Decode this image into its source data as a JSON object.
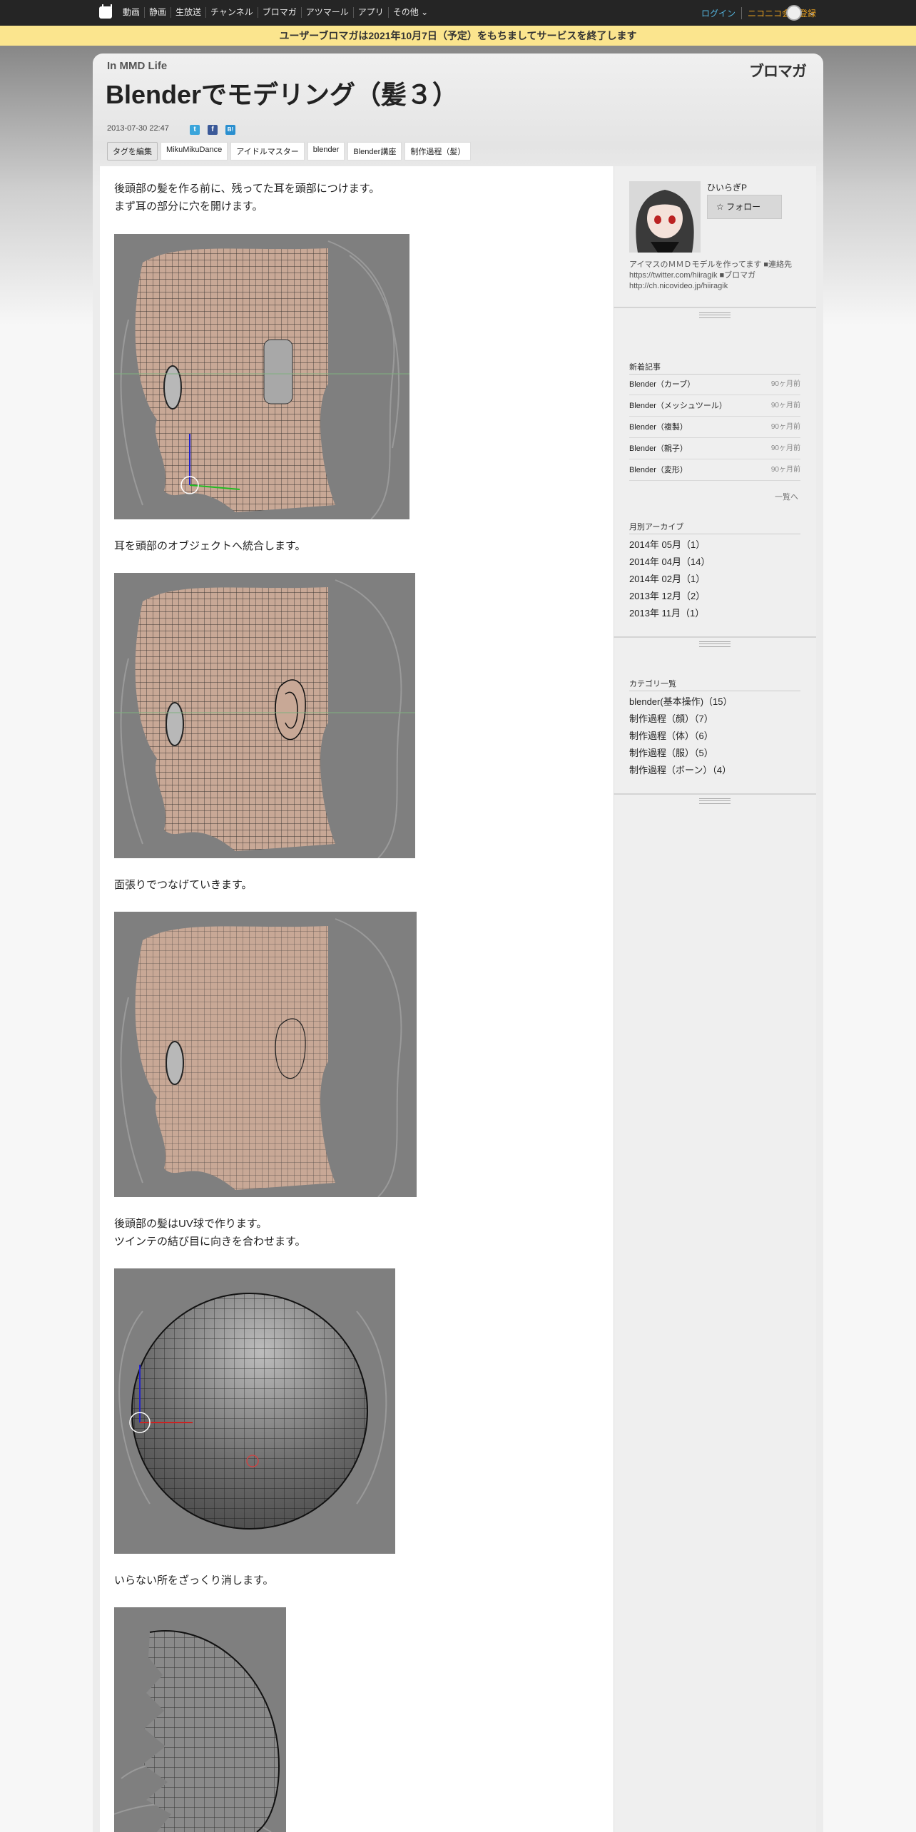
{
  "nav": {
    "links": [
      "動画",
      "静画",
      "生放送",
      "チャンネル",
      "ブロマガ",
      "アツマール",
      "アプリ",
      "その他"
    ],
    "login": "ログイン",
    "register": "ニコニコ会員登録"
  },
  "notice": "ユーザーブロマガは2021年10月7日（予定）をもちましてサービスを終了します",
  "blog": {
    "name": "In MMD Life",
    "brand": "ブロマガ"
  },
  "post": {
    "title": "Blenderでモデリング（髪３）",
    "date": "2013-07-30 22:47",
    "tag_edit": "タグを編集",
    "tags": [
      "MikuMikuDance",
      "アイドルマスター",
      "blender",
      "Blender講座",
      "制作過程（髪）"
    ],
    "paragraphs": [
      "後頭部の髪を作る前に、残ってた耳を頭部につけます。",
      "まず耳の部分に穴を開けます。",
      "耳を頭部のオブジェクトへ統合します。",
      "面張りでつなげていきます。",
      "後頭部の髪はUV球で作ります。",
      "ツインテの結び目に向きを合わせます。",
      "いらない所をざっくり消します。"
    ]
  },
  "profile": {
    "name": "ひいらぎP",
    "follow": "フォロー",
    "description": "アイマスのＭＭＤモデルを作ってます ■連絡先　https://twitter.com/hiiragik ■ブロマガ http://ch.nicovideo.jp/hiiragik"
  },
  "recent": {
    "heading": "新着記事",
    "items": [
      {
        "title": "Blender（カーブ）",
        "ago": "90ヶ月前"
      },
      {
        "title": "Blender（メッシュツール）",
        "ago": "90ヶ月前"
      },
      {
        "title": "Blender（複製）",
        "ago": "90ヶ月前"
      },
      {
        "title": "Blender（親子）",
        "ago": "90ヶ月前"
      },
      {
        "title": "Blender（変形）",
        "ago": "90ヶ月前"
      }
    ],
    "more": "一覧へ"
  },
  "archive": {
    "heading": "月別アーカイブ",
    "items": [
      "2014年 05月（1）",
      "2014年 04月（14）",
      "2014年 02月（1）",
      "2013年 12月（2）",
      "2013年 11月（1）"
    ]
  },
  "categories": {
    "heading": "カテゴリ一覧",
    "items": [
      "blender(基本操作)（15）",
      "制作過程（顔）（7）",
      "制作過程（体）（6）",
      "制作過程（服）（5）",
      "制作過程（ボーン）（4）"
    ]
  }
}
